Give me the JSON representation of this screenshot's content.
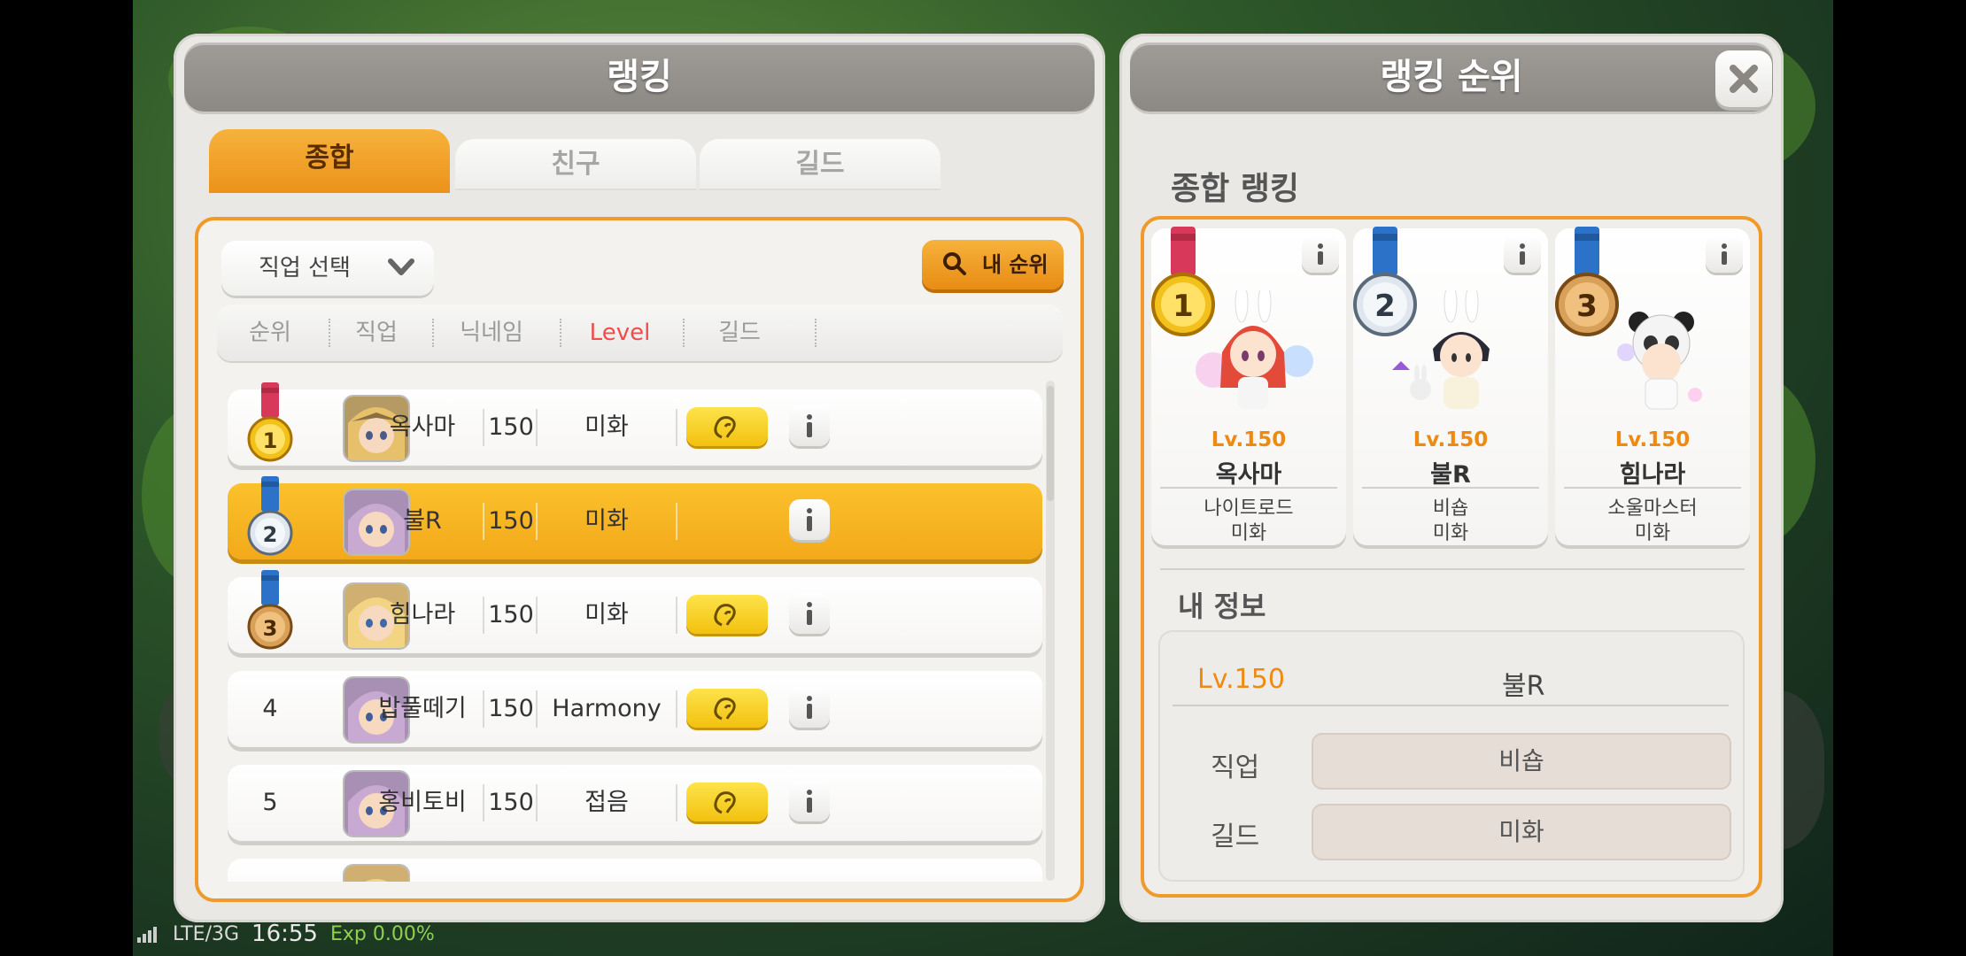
{
  "left_panel": {
    "title": "랭킹",
    "tabs": [
      {
        "label": "종합",
        "active": true
      },
      {
        "label": "친구",
        "active": false
      },
      {
        "label": "길드",
        "active": false
      }
    ],
    "job_select_label": "직업 선택",
    "my_rank_label": "내 순위",
    "columns": [
      "순위",
      "직업",
      "닉네임",
      "Level",
      "길드"
    ],
    "rows": [
      {
        "rank": "1",
        "nickname": "옥사마",
        "level": "150",
        "guild": "미화",
        "is_me": false,
        "medal": "gold"
      },
      {
        "rank": "2",
        "nickname": "불R",
        "level": "150",
        "guild": "미화",
        "is_me": true,
        "medal": "silver"
      },
      {
        "rank": "3",
        "nickname": "힘나라",
        "level": "150",
        "guild": "미화",
        "is_me": false,
        "medal": "bronze"
      },
      {
        "rank": "4",
        "nickname": "밥풀떼기",
        "level": "150",
        "guild": "Harmony",
        "is_me": false,
        "medal": ""
      },
      {
        "rank": "5",
        "nickname": "홍비토비",
        "level": "150",
        "guild": "접음",
        "is_me": false,
        "medal": ""
      }
    ]
  },
  "right_panel": {
    "title": "랭킹 순위",
    "section_title": "종합 랭킹",
    "top3": [
      {
        "rank": "1",
        "level": "Lv.150",
        "nickname": "옥사마",
        "job": "나이트로드",
        "guild": "미화"
      },
      {
        "rank": "2",
        "level": "Lv.150",
        "nickname": "불R",
        "job": "비숍",
        "guild": "미화"
      },
      {
        "rank": "3",
        "level": "Lv.150",
        "nickname": "힘나라",
        "job": "소울마스터",
        "guild": "미화"
      }
    ],
    "my_info": {
      "title": "내 정보",
      "level": "Lv.150",
      "nickname": "불R",
      "job_label": "직업",
      "job_value": "비숍",
      "guild_label": "길드",
      "guild_value": "미화"
    }
  },
  "status_bar": {
    "network": "LTE/3G",
    "time": "16:55",
    "exp": "Exp 0.00%"
  },
  "colors": {
    "accent_orange": "#ef9a2a",
    "highlight_row": "#f6b324",
    "level_orange": "#ef8a10",
    "level_header_red": "#ef4d4d",
    "medal_gold": "#f3c11b",
    "medal_silver": "#dfe6ee",
    "medal_bronze": "#d9a05a"
  }
}
